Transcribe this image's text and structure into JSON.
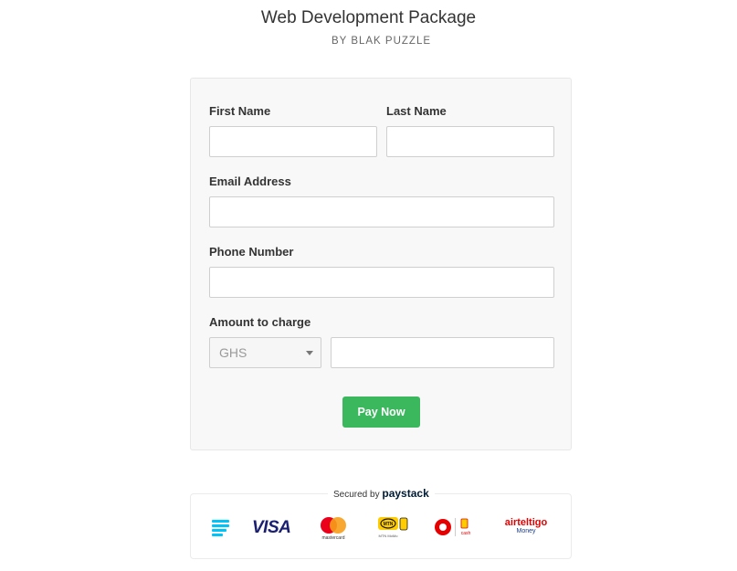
{
  "header": {
    "title": "Web Development Package",
    "subtitle": "BY BLAK PUZZLE"
  },
  "form": {
    "first_name_label": "First Name",
    "first_name_value": "",
    "last_name_label": "Last Name",
    "last_name_value": "",
    "email_label": "Email Address",
    "email_value": "",
    "phone_label": "Phone Number",
    "phone_value": "",
    "amount_label": "Amount to charge",
    "currency_selected": "GHS",
    "amount_value": "",
    "submit_label": "Pay Now"
  },
  "footer": {
    "secured_prefix": "Secured by",
    "secured_brand": "paystack",
    "logos": [
      {
        "name": "paystack-logo",
        "text": ""
      },
      {
        "name": "visa-logo",
        "text": "VISA"
      },
      {
        "name": "mastercard-logo",
        "text": "mastercard"
      },
      {
        "name": "mtn-mobile-money-logo",
        "text": "MTN"
      },
      {
        "name": "vodafone-cash-logo",
        "text": "cash"
      },
      {
        "name": "airteltigo-money-logo",
        "text": "airteltigo",
        "sub": "Money"
      }
    ]
  },
  "colors": {
    "accent_green": "#3bb75e",
    "card_bg": "#f8f8f8",
    "paystack_blue": "#00c3f7",
    "visa_blue": "#1a1f71",
    "mastercard_red": "#eb001b",
    "mastercard_orange": "#f79e1b",
    "mtn_yellow": "#ffcc00",
    "vodafone_red": "#e60000",
    "airteltigo_red": "#e40000"
  }
}
